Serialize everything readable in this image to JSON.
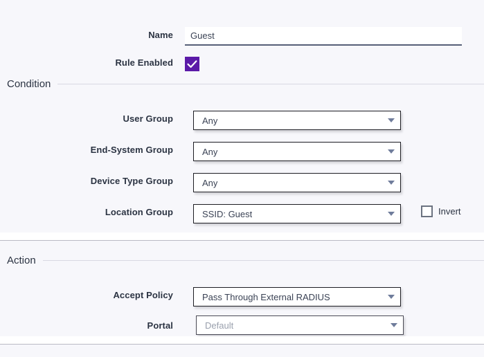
{
  "form": {
    "name": {
      "label": "Name",
      "value": "Guest",
      "placeholder": "Name"
    },
    "rule_enabled": {
      "label": "Rule Enabled",
      "checked": true
    }
  },
  "condition": {
    "legend": "Condition",
    "fields": [
      {
        "label": "User Group",
        "value": "Any"
      },
      {
        "label": "End-System Group",
        "value": "Any"
      },
      {
        "label": "Device Type Group",
        "value": "Any"
      },
      {
        "label": "Location Group",
        "value": "SSID: Guest"
      }
    ],
    "invert": {
      "label": "Invert",
      "checked": false
    }
  },
  "action": {
    "legend": "Action",
    "fields": [
      {
        "label": "Accept Policy",
        "value": "Pass Through External RADIUS"
      },
      {
        "label": "Portal",
        "value": "Default"
      }
    ]
  },
  "colors": {
    "accent_purple": "#5b1aa8",
    "page_background": "#f7f7fb",
    "label_text": "#2b3342",
    "caret": "#6f7c9b",
    "muted_text": "#9aa0ad"
  }
}
